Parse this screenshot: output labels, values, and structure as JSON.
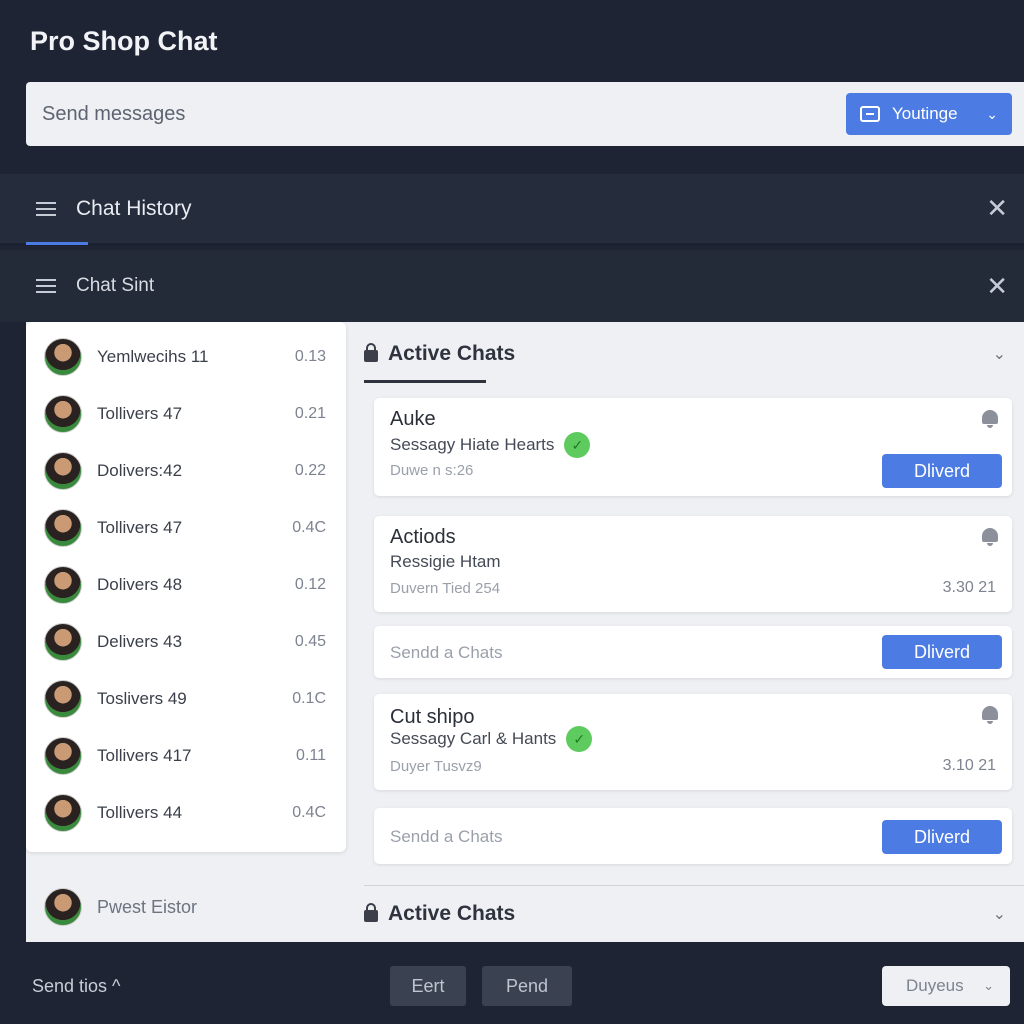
{
  "app": {
    "title": "Pro Shop Chat"
  },
  "search": {
    "placeholder": "Send messages",
    "select_label": "Youtinge"
  },
  "panels": {
    "history": {
      "label": "Chat History"
    },
    "sent": {
      "label": "Chat Sint"
    }
  },
  "contacts": [
    {
      "name": "Yemlwecihs 11",
      "value": "0.13"
    },
    {
      "name": "Tollivers 47",
      "value": "0.21"
    },
    {
      "name": "Dolivers:42",
      "value": "0.22"
    },
    {
      "name": "Tollivers 47",
      "value": "0.4C"
    },
    {
      "name": "Dolivers 48",
      "value": "0.12"
    },
    {
      "name": "Delivers 43",
      "value": "0.45"
    },
    {
      "name": "Toslivers 49",
      "value": "0.1C"
    },
    {
      "name": "Tollivers 417",
      "value": "0.11"
    },
    {
      "name": "Tollivers 44",
      "value": "0.4C"
    }
  ],
  "list_footer": {
    "name": "Pwest Eistor"
  },
  "active_sections": [
    {
      "title": "Active Chats"
    },
    {
      "title": "Active Chats"
    }
  ],
  "cards": [
    {
      "title": "Auke",
      "subtitle": "Sessagy Hiate Hearts",
      "meta": "Duwe n s:26",
      "button": "Dliverd"
    },
    {
      "title": "Actiods",
      "subtitle": "Ressigie Htam",
      "meta": "Duvern Tied 254",
      "time": "3.30 21"
    },
    {
      "placeholder": "Sendd a Chats",
      "button": "Dliverd"
    },
    {
      "title": "Cut shipo",
      "subtitle": "Sessagy Carl & Hants",
      "meta": "Duyer Tusvz9",
      "time": "3.10 21"
    },
    {
      "placeholder": "Sendd a Chats",
      "button": "Dliverd"
    }
  ],
  "bottom": {
    "left_label": "Send tios ^",
    "btn1": "Eert",
    "btn2": "Pend",
    "select": "Duyeus"
  },
  "colors": {
    "accent": "#4c7be3",
    "background": "#1e2433",
    "check": "#5ecb5e"
  }
}
